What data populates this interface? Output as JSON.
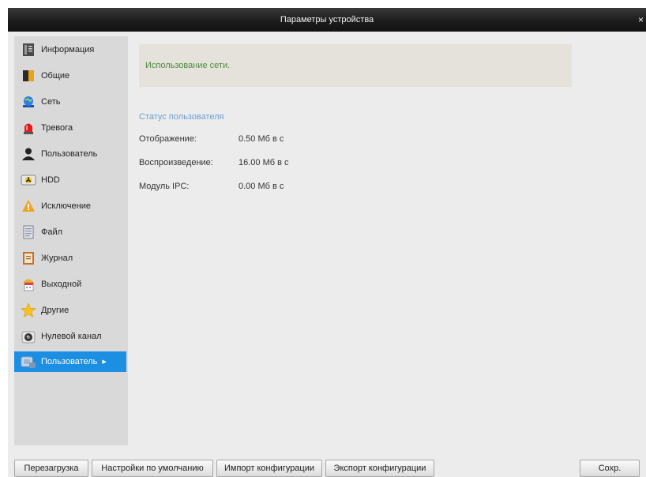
{
  "window": {
    "title": "Параметры устройства",
    "close_glyph": "×"
  },
  "sidebar": {
    "items": [
      {
        "label": "Информация",
        "icon": "info-book-icon"
      },
      {
        "label": "Общие",
        "icon": "general-folder-icon"
      },
      {
        "label": "Сеть",
        "icon": "network-globe-icon"
      },
      {
        "label": "Тревога",
        "icon": "alarm-siren-icon"
      },
      {
        "label": "Пользователь",
        "icon": "user-icon"
      },
      {
        "label": "HDD",
        "icon": "hdd-icon"
      },
      {
        "label": "Исключение",
        "icon": "warning-icon"
      },
      {
        "label": "Файл",
        "icon": "file-icon"
      },
      {
        "label": "Журнал",
        "icon": "log-journal-icon"
      },
      {
        "label": "Выходной",
        "icon": "holiday-calendar-icon"
      },
      {
        "label": "Другие",
        "icon": "star-icon"
      },
      {
        "label": "Нулевой канал",
        "icon": "zero-channel-camera-icon"
      },
      {
        "label": "Пользователь",
        "icon": "network-user-icon",
        "active": true,
        "arrow": "▶"
      }
    ]
  },
  "main": {
    "info_text": "Использование сети.",
    "section_title": "Статус пользователя",
    "rows": [
      {
        "label": "Отображение:",
        "value": "0.50 Мб в с"
      },
      {
        "label": "Воспроизведение:",
        "value": "16.00 Мб в с"
      },
      {
        "label": "Модуль IPC:",
        "value": "0.00 Мб в с"
      }
    ]
  },
  "footer": {
    "reboot": "Перезагрузка",
    "defaults": "Настройки по умолчанию",
    "import": "Импорт конфигурации",
    "export": "Экспорт конфигурации",
    "save": "Сохр."
  },
  "colors": {
    "title_bar": "#1c1c1c",
    "active_nav": "#1c8fe3",
    "info_text": "#4c8c3a",
    "section_title": "#6a9fd1"
  }
}
